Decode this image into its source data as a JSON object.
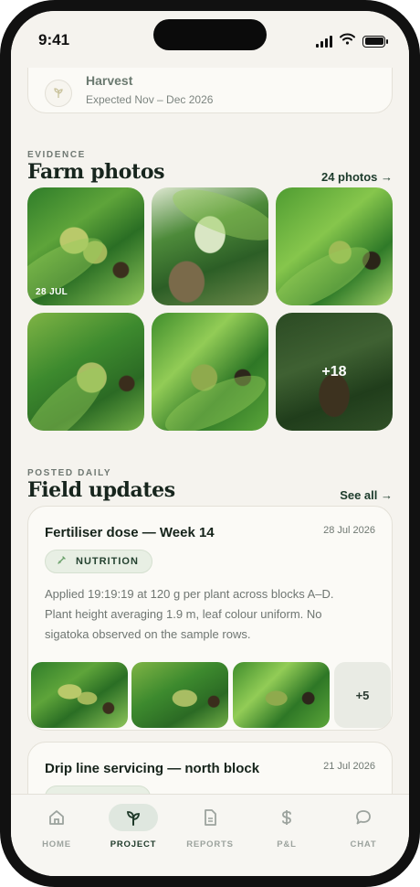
{
  "status_bar": {
    "time": "9:41"
  },
  "harvest": {
    "title": "Harvest",
    "subtitle": "Expected Nov – Dec 2026"
  },
  "evidence": {
    "eyebrow": "EVIDENCE",
    "title": "Farm photos",
    "link": "24 photos →",
    "photos": [
      {
        "label": "28 JUL"
      },
      {
        "label": ""
      },
      {
        "label": ""
      },
      {
        "label": ""
      },
      {
        "label": ""
      },
      {
        "label": "+18"
      }
    ]
  },
  "field_updates": {
    "eyebrow": "POSTED DAILY",
    "title": "Field updates",
    "link": "See all →",
    "items": [
      {
        "title": "Fertiliser dose — Week 14",
        "date": "28 Jul 2026",
        "tag": "NUTRITION",
        "tag_icon": "syringe-icon",
        "body": "Applied 19:19:19 at 120 g per plant across blocks A–D. Plant height averaging 1.9 m, leaf colour uniform. No sigatoka observed on the sample rows.",
        "more_photos": "+5"
      },
      {
        "title": "Drip line servicing — north block",
        "date": "21 Jul 2026"
      }
    ]
  },
  "tabs": [
    {
      "label": "HOME",
      "icon": "home-icon",
      "active": false
    },
    {
      "label": "PROJECT",
      "icon": "sprout-icon",
      "active": true
    },
    {
      "label": "REPORTS",
      "icon": "document-icon",
      "active": false
    },
    {
      "label": "P&L",
      "icon": "dollar-icon",
      "active": false
    },
    {
      "label": "CHAT",
      "icon": "chat-bubble-icon",
      "active": false
    }
  ],
  "colors": {
    "accent": "#1f3a2a",
    "background": "#f5f3ee",
    "tag_bg": "#e8efe4"
  }
}
